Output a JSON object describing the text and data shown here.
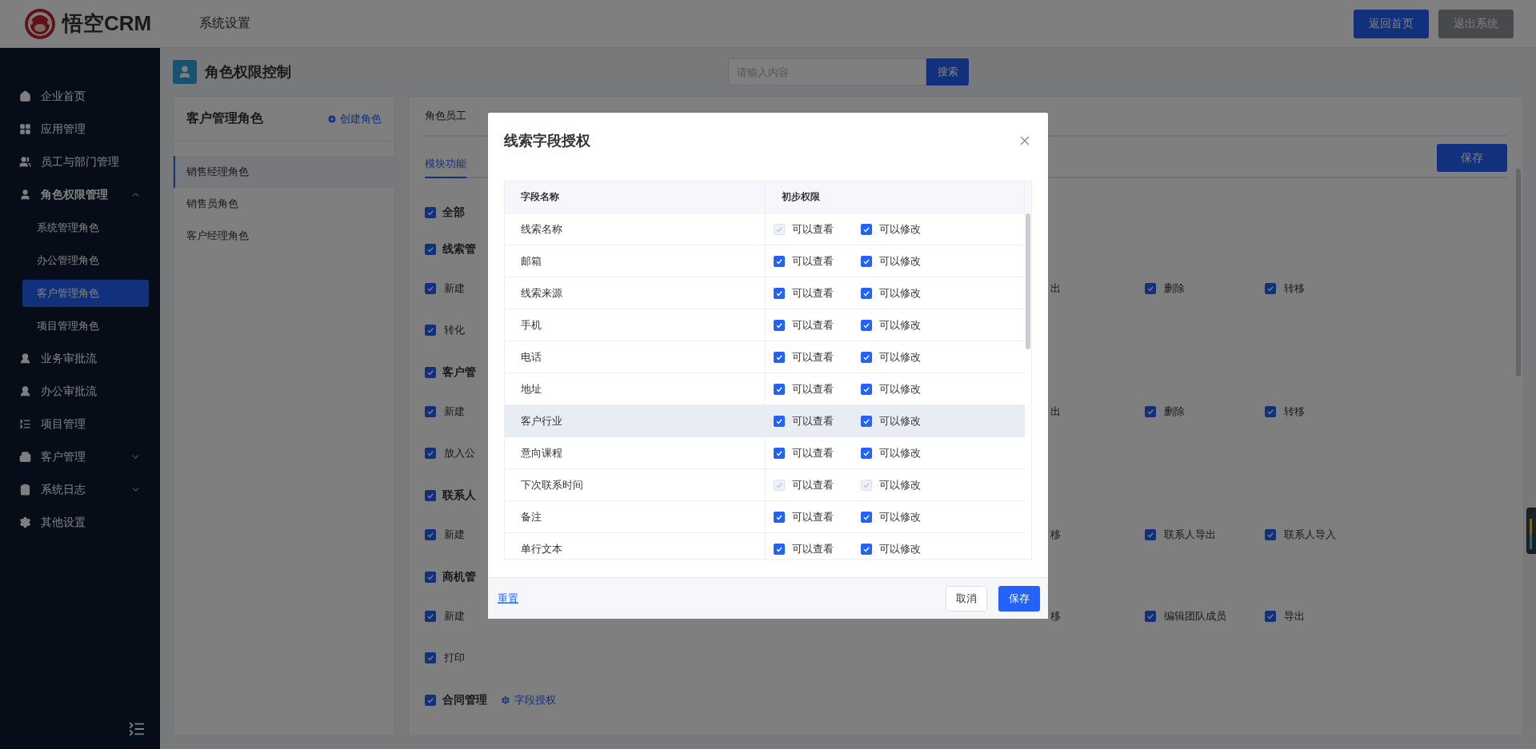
{
  "header": {
    "logo_text": "悟空CRM",
    "section": "系统设置",
    "buttons": [
      {
        "label": "返回首页",
        "kind": "primary"
      },
      {
        "label": "退出系统",
        "kind": "muted"
      }
    ]
  },
  "sidebar": {
    "items": [
      {
        "label": "企业首页",
        "selected": false
      },
      {
        "label": "应用管理",
        "selected": false
      },
      {
        "label": "员工与部门管理",
        "selected": false
      },
      {
        "label": "角色权限管理",
        "selected": false,
        "expanded": true,
        "children": [
          {
            "label": "系统管理角色",
            "selected": false
          },
          {
            "label": "办公管理角色",
            "selected": false
          },
          {
            "label": "客户管理角色",
            "selected": true
          },
          {
            "label": "项目管理角色",
            "selected": false
          }
        ]
      },
      {
        "label": "业务审批流",
        "selected": false
      },
      {
        "label": "办公审批流",
        "selected": false
      },
      {
        "label": "项目管理",
        "selected": false
      },
      {
        "label": "客户管理",
        "selected": false,
        "expanded": false
      },
      {
        "label": "系统日志",
        "selected": false,
        "expanded": false
      },
      {
        "label": "其他设置",
        "selected": false
      }
    ]
  },
  "page": {
    "title": "角色权限控制",
    "search": {
      "placeholder": "请输入内容",
      "button": "搜索"
    }
  },
  "roles_panel": {
    "title": "客户管理角色",
    "create_link": "创建角色",
    "roles": [
      {
        "label": "销售经理角色",
        "selected": true
      },
      {
        "label": "销售员角色",
        "selected": false
      },
      {
        "label": "客户经理角色",
        "selected": false
      }
    ]
  },
  "permissions_panel": {
    "top_tab": "角色员工",
    "tabs": [
      {
        "label": "模块功能",
        "selected": true
      }
    ],
    "save_button": "保存",
    "groups": [
      {
        "title": "全部",
        "checked": true
      },
      {
        "title": "线索管",
        "checked": true,
        "rows": [
          {
            "left": [
              {
                "label": "新建",
                "checked": true
              }
            ],
            "right": [
              {
                "label": "出"
              },
              {
                "label": "删除",
                "checked": true
              },
              {
                "label": "转移",
                "checked": true
              }
            ]
          },
          {
            "left": [
              {
                "label": "转化",
                "checked": true
              }
            ],
            "right": []
          }
        ]
      },
      {
        "title": "客户管",
        "checked": true,
        "rows": [
          {
            "left": [
              {
                "label": "新建",
                "checked": true
              }
            ],
            "right": [
              {
                "label": "出"
              },
              {
                "label": "删除",
                "checked": true
              },
              {
                "label": "转移",
                "checked": true
              }
            ]
          },
          {
            "left": [
              {
                "label": "放入公",
                "checked": true
              }
            ],
            "right": []
          }
        ]
      },
      {
        "title": "联系人",
        "checked": true,
        "rows": [
          {
            "left": [
              {
                "label": "新建",
                "checked": true
              }
            ],
            "right": [
              {
                "label": "移"
              },
              {
                "label": "联系人导出",
                "checked": true
              },
              {
                "label": "联系人导入",
                "checked": true
              }
            ]
          }
        ]
      },
      {
        "title": "商机管",
        "checked": true,
        "rows": [
          {
            "left": [
              {
                "label": "新建",
                "checked": true
              }
            ],
            "right": [
              {
                "label": "移"
              },
              {
                "label": "编辑团队成员",
                "checked": true
              },
              {
                "label": "导出",
                "checked": true
              }
            ]
          },
          {
            "left": [
              {
                "label": "打印",
                "checked": true
              }
            ],
            "right": []
          }
        ]
      },
      {
        "title": "合同管理",
        "checked": true,
        "link": "字段授权"
      }
    ]
  },
  "dialog": {
    "title": "线索字段授权",
    "columns": [
      "字段名称",
      "初步权限"
    ],
    "rows": [
      {
        "name": "线索名称",
        "highlighted": false,
        "view": {
          "label": "可以查看",
          "checked": true,
          "disabled": true
        },
        "edit": {
          "label": "可以修改",
          "checked": true,
          "disabled": false
        }
      },
      {
        "name": "邮箱",
        "highlighted": false,
        "view": {
          "label": "可以查看",
          "checked": true,
          "disabled": false
        },
        "edit": {
          "label": "可以修改",
          "checked": true,
          "disabled": false
        }
      },
      {
        "name": "线索来源",
        "highlighted": false,
        "view": {
          "label": "可以查看",
          "checked": true,
          "disabled": false
        },
        "edit": {
          "label": "可以修改",
          "checked": true,
          "disabled": false
        }
      },
      {
        "name": "手机",
        "highlighted": false,
        "view": {
          "label": "可以查看",
          "checked": true,
          "disabled": false
        },
        "edit": {
          "label": "可以修改",
          "checked": true,
          "disabled": false
        }
      },
      {
        "name": "电话",
        "highlighted": false,
        "view": {
          "label": "可以查看",
          "checked": true,
          "disabled": false
        },
        "edit": {
          "label": "可以修改",
          "checked": true,
          "disabled": false
        }
      },
      {
        "name": "地址",
        "highlighted": false,
        "view": {
          "label": "可以查看",
          "checked": true,
          "disabled": false
        },
        "edit": {
          "label": "可以修改",
          "checked": true,
          "disabled": false
        }
      },
      {
        "name": "客户行业",
        "highlighted": true,
        "view": {
          "label": "可以查看",
          "checked": true,
          "disabled": false
        },
        "edit": {
          "label": "可以修改",
          "checked": true,
          "disabled": false
        }
      },
      {
        "name": "意向课程",
        "highlighted": false,
        "view": {
          "label": "可以查看",
          "checked": true,
          "disabled": false
        },
        "edit": {
          "label": "可以修改",
          "checked": true,
          "disabled": false
        }
      },
      {
        "name": "下次联系时间",
        "highlighted": false,
        "view": {
          "label": "可以查看",
          "checked": true,
          "disabled": true
        },
        "edit": {
          "label": "可以修改",
          "checked": true,
          "disabled": true
        }
      },
      {
        "name": "备注",
        "highlighted": false,
        "view": {
          "label": "可以查看",
          "checked": true,
          "disabled": false
        },
        "edit": {
          "label": "可以修改",
          "checked": true,
          "disabled": false
        }
      },
      {
        "name": "单行文本",
        "highlighted": false,
        "view": {
          "label": "可以查看",
          "checked": true,
          "disabled": false
        },
        "edit": {
          "label": "可以修改",
          "checked": true,
          "disabled": false
        }
      }
    ],
    "reset_link": "重置",
    "cancel_button": "取消",
    "save_button": "保存"
  }
}
